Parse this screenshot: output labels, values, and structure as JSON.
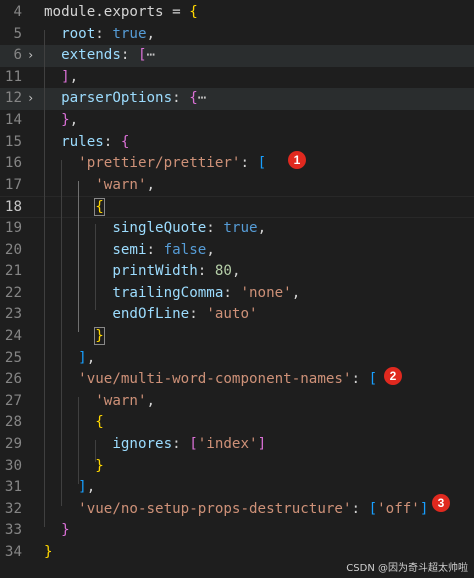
{
  "lines": [
    {
      "n": "4",
      "tokens": [
        [
          "t",
          "module.exports = "
        ],
        [
          "br1",
          "{"
        ]
      ]
    },
    {
      "n": "5",
      "tokens": [
        [
          "k",
          "  root"
        ],
        [
          "t",
          ": "
        ],
        [
          "b",
          "true"
        ],
        [
          "t",
          ","
        ]
      ]
    },
    {
      "n": "6",
      "fold": true,
      "hl": true,
      "tokens": [
        [
          "k",
          "  extends"
        ],
        [
          "t",
          ": "
        ],
        [
          "br2",
          "["
        ],
        [
          "dots",
          "⋯"
        ]
      ]
    },
    {
      "n": "11",
      "tokens": [
        [
          "t",
          "  "
        ],
        [
          "br2",
          "]"
        ],
        [
          "t",
          ","
        ]
      ]
    },
    {
      "n": "12",
      "fold": true,
      "hl": true,
      "tokens": [
        [
          "k",
          "  parserOptions"
        ],
        [
          "t",
          ": "
        ],
        [
          "br2",
          "{"
        ],
        [
          "dots",
          "⋯"
        ]
      ]
    },
    {
      "n": "14",
      "tokens": [
        [
          "t",
          "  "
        ],
        [
          "br2",
          "}"
        ],
        [
          "t",
          ","
        ]
      ]
    },
    {
      "n": "15",
      "tokens": [
        [
          "k",
          "  rules"
        ],
        [
          "t",
          ": "
        ],
        [
          "br2",
          "{"
        ]
      ]
    },
    {
      "n": "16",
      "tokens": [
        [
          "s",
          "    'prettier/prettier'"
        ],
        [
          "t",
          ": "
        ],
        [
          "br3",
          "["
        ]
      ]
    },
    {
      "n": "17",
      "tokens": [
        [
          "s",
          "      'warn'"
        ],
        [
          "t",
          ","
        ]
      ]
    },
    {
      "n": "18",
      "cur": true,
      "tokens": [
        [
          "t",
          "      "
        ],
        [
          "br1box",
          "{"
        ]
      ]
    },
    {
      "n": "19",
      "tokens": [
        [
          "k",
          "        singleQuote"
        ],
        [
          "t",
          ": "
        ],
        [
          "b",
          "true"
        ],
        [
          "t",
          ","
        ]
      ]
    },
    {
      "n": "20",
      "tokens": [
        [
          "k",
          "        semi"
        ],
        [
          "t",
          ": "
        ],
        [
          "b",
          "false"
        ],
        [
          "t",
          ","
        ]
      ]
    },
    {
      "n": "21",
      "tokens": [
        [
          "k",
          "        printWidth"
        ],
        [
          "t",
          ": "
        ],
        [
          "n",
          "80"
        ],
        [
          "t",
          ","
        ]
      ]
    },
    {
      "n": "22",
      "tokens": [
        [
          "k",
          "        trailingComma"
        ],
        [
          "t",
          ": "
        ],
        [
          "s",
          "'none'"
        ],
        [
          "t",
          ","
        ]
      ]
    },
    {
      "n": "23",
      "tokens": [
        [
          "k",
          "        endOfLine"
        ],
        [
          "t",
          ": "
        ],
        [
          "s",
          "'auto'"
        ]
      ]
    },
    {
      "n": "24",
      "tokens": [
        [
          "t",
          "      "
        ],
        [
          "br1box",
          "}"
        ]
      ]
    },
    {
      "n": "25",
      "tokens": [
        [
          "t",
          "    "
        ],
        [
          "br3",
          "]"
        ],
        [
          "t",
          ","
        ]
      ]
    },
    {
      "n": "26",
      "tokens": [
        [
          "s",
          "    'vue/multi-word-component-names'"
        ],
        [
          "t",
          ": "
        ],
        [
          "br3",
          "["
        ]
      ]
    },
    {
      "n": "27",
      "tokens": [
        [
          "s",
          "      'warn'"
        ],
        [
          "t",
          ","
        ]
      ]
    },
    {
      "n": "28",
      "tokens": [
        [
          "t",
          "      "
        ],
        [
          "br1",
          "{"
        ]
      ]
    },
    {
      "n": "29",
      "tokens": [
        [
          "k",
          "        ignores"
        ],
        [
          "t",
          ": "
        ],
        [
          "br2",
          "["
        ],
        [
          "s",
          "'index'"
        ],
        [
          "br2",
          "]"
        ]
      ]
    },
    {
      "n": "30",
      "tokens": [
        [
          "t",
          "      "
        ],
        [
          "br1",
          "}"
        ]
      ]
    },
    {
      "n": "31",
      "tokens": [
        [
          "t",
          "    "
        ],
        [
          "br3",
          "]"
        ],
        [
          "t",
          ","
        ]
      ]
    },
    {
      "n": "32",
      "tokens": [
        [
          "s",
          "    'vue/no-setup-props-destructure'"
        ],
        [
          "t",
          ": "
        ],
        [
          "br3",
          "["
        ],
        [
          "s",
          "'off'"
        ],
        [
          "br3",
          "]"
        ]
      ]
    },
    {
      "n": "33",
      "tokens": [
        [
          "t",
          "  "
        ],
        [
          "br2",
          "}"
        ]
      ]
    },
    {
      "n": "34",
      "tokens": [
        [
          "br1",
          "}"
        ]
      ]
    }
  ],
  "badges": [
    {
      "label": "1"
    },
    {
      "label": "2"
    },
    {
      "label": "3"
    }
  ],
  "watermark": "CSDN @因为奇斗超太帅啦",
  "colors": {
    "background": "#1e1e1e",
    "badge": "#e0291f",
    "string": "#ce9178",
    "property": "#9cdcfe",
    "keyword": "#569cd6"
  }
}
